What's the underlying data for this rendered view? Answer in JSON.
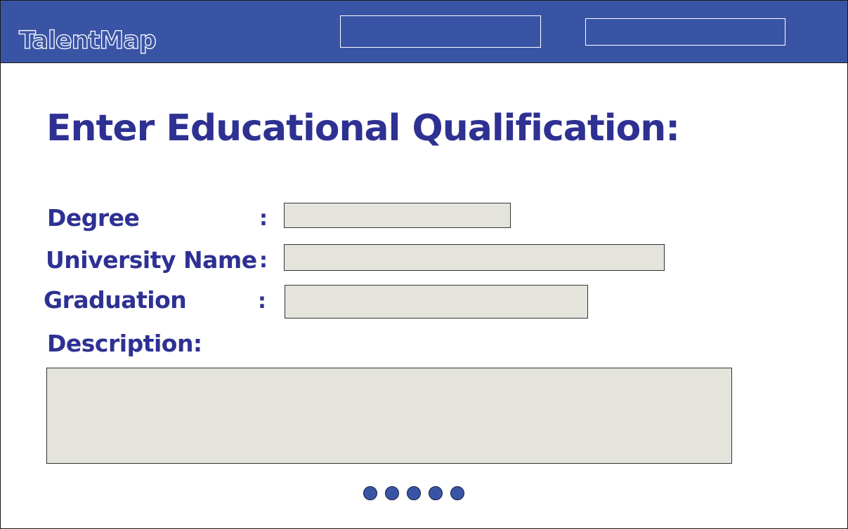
{
  "app": {
    "logo_text": "TalentMap"
  },
  "header": {
    "nav_boxes": [
      "",
      ""
    ]
  },
  "form": {
    "title": "Enter Educational Qualification:",
    "degree": {
      "label": "Degree",
      "separator": ":",
      "value": "",
      "placeholder": ""
    },
    "university": {
      "label": "University Name",
      "separator": ":",
      "value": "",
      "placeholder": ""
    },
    "graduation": {
      "label": "Graduation",
      "separator": ":",
      "value": "",
      "placeholder": ""
    },
    "description": {
      "label": "Description:",
      "value": "",
      "placeholder": ""
    }
  },
  "pagination": {
    "dot_count": 5
  },
  "colors": {
    "header_bg": "#3a54a5",
    "title_text": "#2e3192",
    "input_bg": "#e4e4dc",
    "dot_fill": "#3a54a5"
  }
}
